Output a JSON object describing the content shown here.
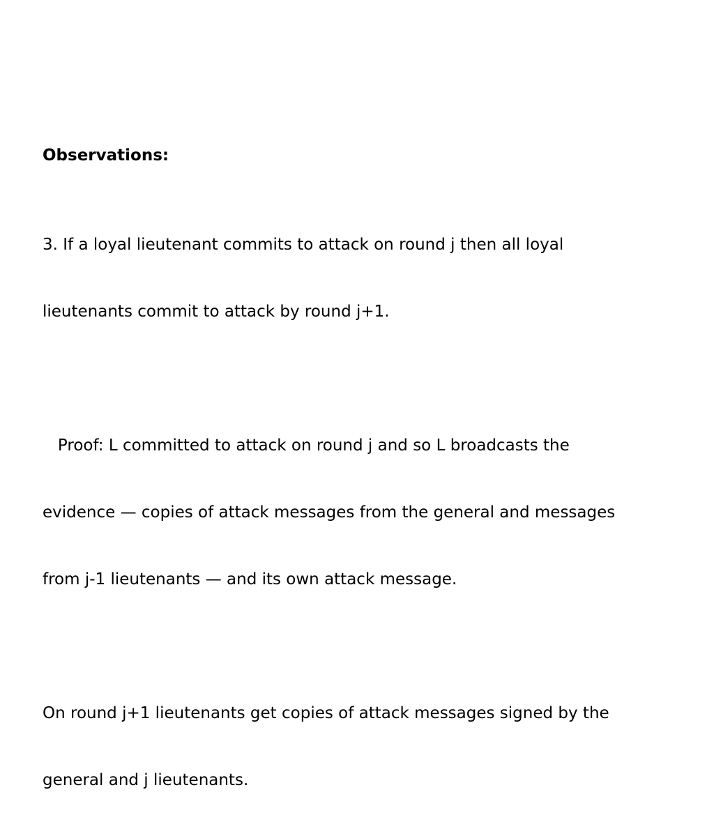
{
  "slide": {
    "heading": "Observations:",
    "observation": {
      "lines": [
        "3. If a loyal lieutenant commits to attack on round j then all loyal",
        "lieutenants commit to attack by round j+1."
      ]
    },
    "proof": {
      "lines": [
        "   Proof: L committed to attack on round j and so L broadcasts the",
        "evidence — copies of attack messages from the general and messages",
        "from j-1 lieutenants — and its own attack message."
      ]
    },
    "conclusion": {
      "lines": [
        "On round j+1 lieutenants get copies of attack messages signed by the",
        "general and j lieutenants."
      ]
    }
  }
}
